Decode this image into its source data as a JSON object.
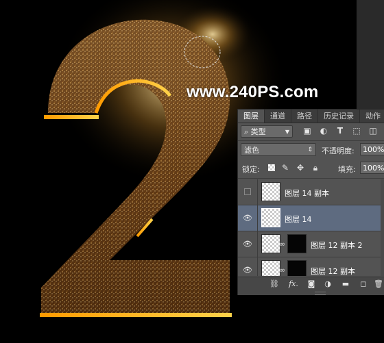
{
  "watermark": "www.240PS.com",
  "tabs": [
    {
      "label": "图层",
      "active": true
    },
    {
      "label": "通道",
      "active": false
    },
    {
      "label": "路径",
      "active": false
    },
    {
      "label": "历史记录",
      "active": false
    },
    {
      "label": "动作",
      "active": false
    }
  ],
  "filter": {
    "kind_label": "类型",
    "icons": [
      "image-filter-icon",
      "adjustment-filter-icon",
      "type-filter-icon",
      "shape-filter-icon",
      "smart-object-filter-icon"
    ],
    "type_glyph": "T"
  },
  "blend": {
    "mode": "滤色",
    "opacity_label": "不透明度:",
    "opacity_value": "100%"
  },
  "lock": {
    "label": "锁定:",
    "fill_label": "填充:",
    "fill_value": "100%"
  },
  "layers": [
    {
      "name": "图层 14 副本",
      "visible": false,
      "selected": false,
      "has_mask": false
    },
    {
      "name": "图层 14",
      "visible": true,
      "selected": true,
      "has_mask": false
    },
    {
      "name": "图层 12 副本 2",
      "visible": true,
      "selected": false,
      "has_mask": true
    },
    {
      "name": "图层 12 副本",
      "visible": true,
      "selected": false,
      "has_mask": true
    }
  ],
  "bottom_icons": [
    "link-layers-icon",
    "fx-icon",
    "add-mask-icon",
    "adjustment-layer-icon",
    "new-group-icon",
    "new-layer-icon",
    "delete-layer-icon"
  ],
  "bottom_fx": "fx.",
  "colors": {
    "panel_bg": "#535353",
    "selected_row": "#5e6b80",
    "gold": "#d9a441"
  }
}
